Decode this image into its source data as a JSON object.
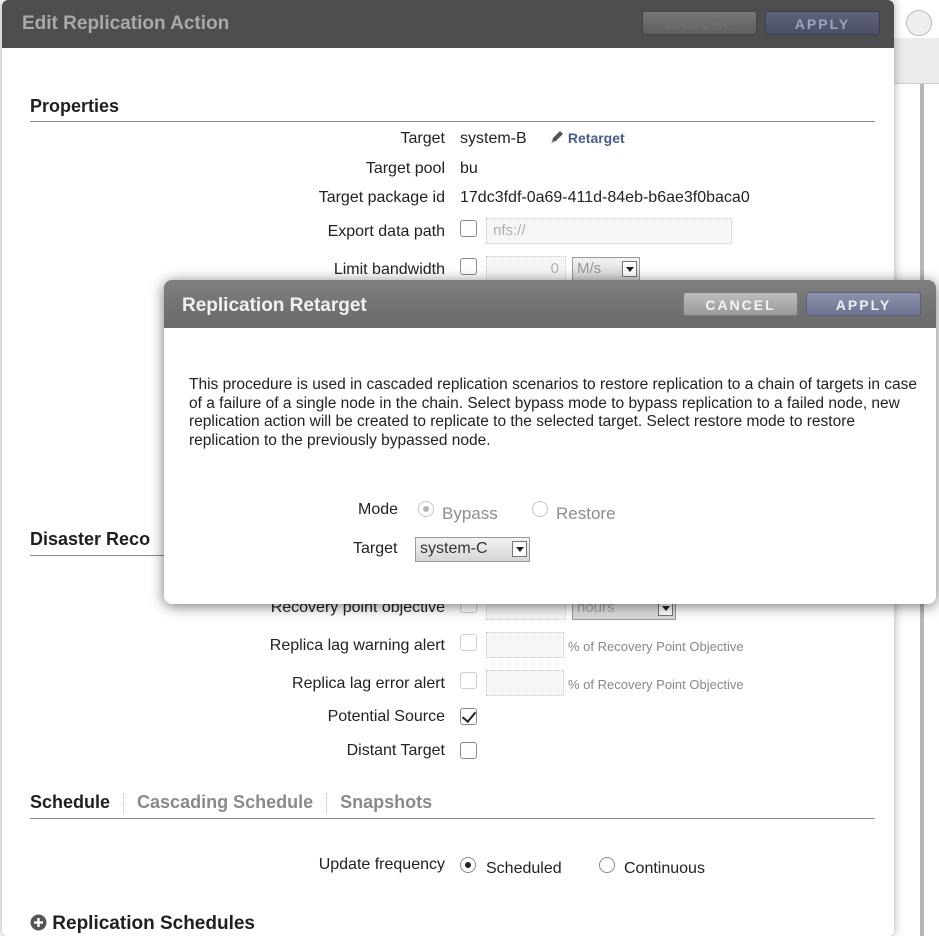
{
  "main_dialog": {
    "title": "Edit Replication Action",
    "cancel_label": "CANCEL",
    "apply_label": "APPLY"
  },
  "properties": {
    "heading": "Properties",
    "target_label": "Target",
    "target_value": "system-B",
    "retarget_label": "Retarget",
    "target_pool_label": "Target pool",
    "target_pool_value": "bu",
    "target_package_label": "Target package id",
    "target_package_value": "17dc3fdf-0a69-411d-84eb-b6ae3f0baca0",
    "export_path_label": "Export data path",
    "export_path_value": "nfs://",
    "limit_bandwidth_label": "Limit bandwidth",
    "limit_bandwidth_value": "0",
    "bandwidth_unit": "M/s"
  },
  "disaster_recovery": {
    "heading": "Disaster Reco",
    "recovery_point_label": "Recovery point objective",
    "recovery_point_unit": "hours",
    "lag_warning_label": "Replica lag warning alert",
    "lag_error_label": "Replica lag error alert",
    "lag_unit_note": "% of Recovery Point Objective",
    "potential_source_label": "Potential Source",
    "potential_source_checked": true,
    "distant_target_label": "Distant Target",
    "distant_target_checked": false
  },
  "tabs": {
    "schedule": "Schedule",
    "cascading_schedule": "Cascading Schedule",
    "snapshots": "Snapshots"
  },
  "schedule": {
    "update_frequency_label": "Update frequency",
    "option_scheduled": "Scheduled",
    "option_continuous": "Continuous",
    "selected": "Scheduled",
    "replication_schedules_heading": "Replication Schedules"
  },
  "retarget_modal": {
    "title": "Replication Retarget",
    "cancel_label": "CANCEL",
    "apply_label": "APPLY",
    "description": "This procedure is used in cascaded replication scenarios to restore replication to a chain of targets in case of a failure of a single node in the chain. Select bypass mode to bypass replication to a failed node, new replication action will be created to replicate to the selected target. Select restore mode to restore replication to the previously bypassed node.",
    "mode_label": "Mode",
    "mode_bypass": "Bypass",
    "mode_restore": "Restore",
    "mode_selected": "Bypass",
    "target_label": "Target",
    "target_value": "system-C"
  },
  "colors": {
    "header_dark": "#4e4e4e",
    "modal_header": "#747474",
    "apply_button": "#7a7f9e",
    "cancel_button": "#ababab"
  },
  "icons": {
    "retarget": "pencil-icon",
    "replication_schedules": "plus-circle-icon"
  }
}
